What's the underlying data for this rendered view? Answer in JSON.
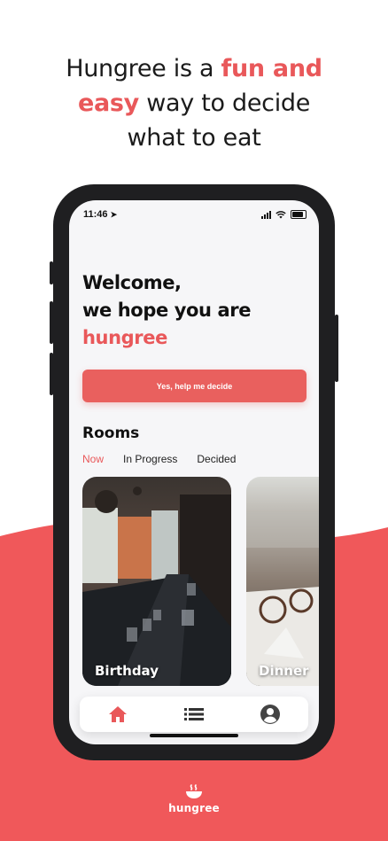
{
  "headline": {
    "line1_pre": "Hungree is a ",
    "line1_accent": "fun and",
    "line2_accent": "easy",
    "line2_post": " way to decide",
    "line3": "what to eat"
  },
  "status_bar": {
    "time": "11:46"
  },
  "welcome": {
    "line1": "Welcome,",
    "line2": "we hope you are",
    "line3": "hungree"
  },
  "cta_label": "Yes, help me decide",
  "rooms": {
    "title": "Rooms",
    "tabs": [
      {
        "label": "Now",
        "active": true
      },
      {
        "label": "In Progress",
        "active": false
      },
      {
        "label": "Decided",
        "active": false
      }
    ],
    "cards": [
      {
        "label": "Birthday"
      },
      {
        "label": "Dinner"
      }
    ]
  },
  "tab_bar": {
    "icons": [
      "home-icon",
      "list-icon",
      "profile-icon"
    ]
  },
  "brand": {
    "logo_text": "hungree"
  },
  "colors": {
    "accent": "#e9585a",
    "coral_bg": "#f0585a",
    "phone": "#1f1f21"
  }
}
